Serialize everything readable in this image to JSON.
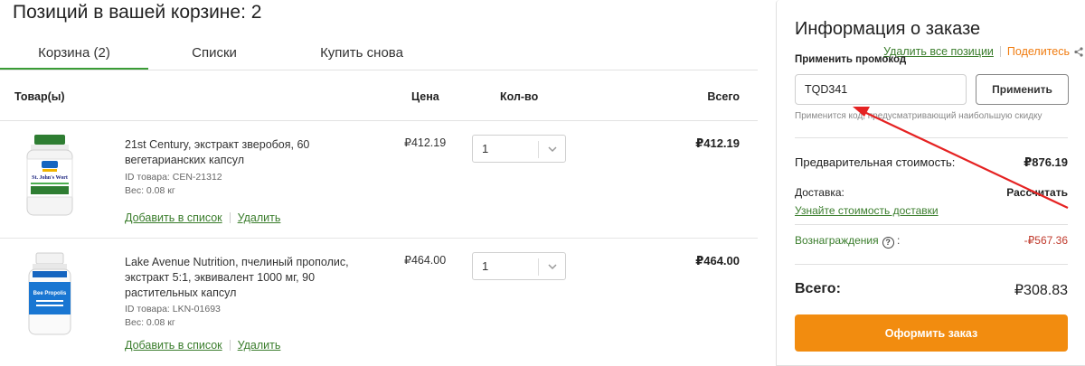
{
  "cart": {
    "title": "Позиций в вашей корзине: 2",
    "tabs": [
      {
        "label": "Корзина (2)",
        "active": true
      },
      {
        "label": "Списки",
        "active": false
      },
      {
        "label": "Купить снова",
        "active": false
      }
    ],
    "remove_all": "Удалить все позиции",
    "share": "Поделитесь",
    "columns": {
      "product": "Товар(ы)",
      "price": "Цена",
      "qty": "Кол-во",
      "total": "Всего"
    },
    "items": [
      {
        "name": "21st Century, экстракт зверобоя, 60 вегетарианских капсул",
        "product_id": "ID товара: CEN-21312",
        "weight": "Вес: 0.08 кг",
        "price": "₽412.19",
        "qty": "1",
        "total": "₽412.19",
        "add_to_list": "Добавить в список",
        "remove": "Удалить",
        "image_label": "St. John's Wort"
      },
      {
        "name": "Lake Avenue Nutrition, пчелиный прополис, экстракт 5:1, эквивалент 1000 мг, 90 растительных капсул",
        "product_id": "ID товара: LKN-01693",
        "weight": "Вес: 0.08 кг",
        "price": "₽464.00",
        "qty": "1",
        "total": "₽464.00",
        "add_to_list": "Добавить в список",
        "remove": "Удалить",
        "image_label": "Bee Propolis"
      }
    ]
  },
  "order": {
    "title": "Информация о заказе",
    "promo_label": "Применить промокод",
    "promo_value": "TQD341",
    "apply_button": "Применить",
    "promo_hint": "Применится код, предусматривающий наибольшую скидку",
    "subtotal_label": "Предварительная стоимость:",
    "subtotal_value": "₽876.19",
    "delivery_label": "Доставка:",
    "delivery_value": "Рассчитать",
    "delivery_link": "Узнайте стоимость доставки",
    "rewards_label": "Вознаграждения",
    "rewards_value": "-₽567.36",
    "grand_label": "Всего:",
    "grand_value": "₽308.83",
    "checkout_button": "Оформить заказ"
  },
  "colors": {
    "accent_green": "#3a9c36",
    "accent_orange": "#f28c0f",
    "arrow_red": "#e52222"
  },
  "icons": {
    "share": "share-icon",
    "qty_chevron": "chevron-down-icon",
    "rewards_help": "question-icon"
  }
}
